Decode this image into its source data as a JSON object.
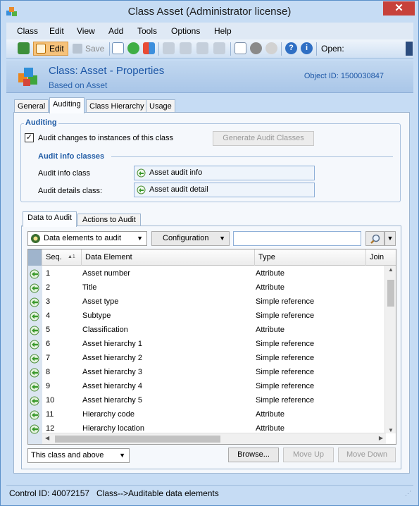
{
  "window": {
    "title": "Class Asset (Administrator license)",
    "close_glyph": "✕"
  },
  "menu": [
    "Class",
    "Edit",
    "View",
    "Add",
    "Tools",
    "Options",
    "Help"
  ],
  "toolbar": {
    "edit_label": "Edit",
    "save_label": "Save",
    "open_label": "Open:"
  },
  "header": {
    "title": "Class: Asset - Properties",
    "subtitle": "Based on Asset",
    "object_id": "Object ID: 1500030847"
  },
  "tabs": [
    "General",
    "Auditing",
    "Class Hierarchy",
    "Usage"
  ],
  "auditing": {
    "group_title": "Auditing",
    "check_label": "Audit changes to instances of this class",
    "check_mark": "✓",
    "generate_button": "Generate Audit Classes",
    "info_title": "Audit info classes",
    "info_class_label": "Audit info class",
    "info_class_value": "Asset audit info",
    "details_class_label": "Audit details class:",
    "details_class_value": "Asset audit detail"
  },
  "lower_tabs": [
    "Data to Audit",
    "Actions to Audit"
  ],
  "filter": {
    "view_select": "Data elements to audit",
    "config_button": "Configuration",
    "search_value": ""
  },
  "grid": {
    "columns": [
      "Seq.",
      "Data Element",
      "Type",
      "Join"
    ],
    "sort_indicator": "▲1",
    "rows": [
      {
        "seq": "1",
        "element": "Asset number",
        "type": "Attribute"
      },
      {
        "seq": "2",
        "element": "Title",
        "type": "Attribute"
      },
      {
        "seq": "3",
        "element": "Asset type",
        "type": "Simple reference"
      },
      {
        "seq": "4",
        "element": "Subtype",
        "type": "Simple reference"
      },
      {
        "seq": "5",
        "element": "Classification",
        "type": "Attribute"
      },
      {
        "seq": "6",
        "element": "Asset hierarchy 1",
        "type": "Simple reference"
      },
      {
        "seq": "7",
        "element": "Asset hierarchy 2",
        "type": "Simple reference"
      },
      {
        "seq": "8",
        "element": "Asset hierarchy 3",
        "type": "Simple reference"
      },
      {
        "seq": "9",
        "element": "Asset hierarchy 4",
        "type": "Simple reference"
      },
      {
        "seq": "10",
        "element": "Asset hierarchy 5",
        "type": "Simple reference"
      },
      {
        "seq": "11",
        "element": "Hierarchy code",
        "type": "Attribute"
      },
      {
        "seq": "12",
        "element": "Hierarchy location",
        "type": "Attribute"
      }
    ]
  },
  "bottom": {
    "scope_select": "This class and above",
    "browse_button": "Browse...",
    "move_up_button": "Move Up",
    "move_down_button": "Move Down"
  },
  "status": {
    "control_id": "Control ID: 40072157",
    "path": "Class-->Auditable data elements"
  },
  "colors": {
    "accent": "#1d57a6",
    "window_bg": "#c6dcf4",
    "close_red": "#c7413a"
  }
}
